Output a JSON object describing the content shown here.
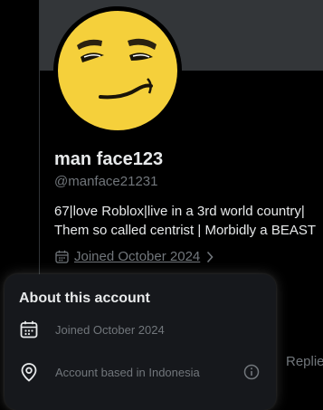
{
  "profile": {
    "display_name": "man face123",
    "handle": "@manface21231",
    "bio_lines": [
      "67|love Roblox|live in a 3rd world country|",
      "Them so called centrist | Morbidly a BEAST"
    ],
    "joined": "Joined October 2024",
    "avatar_icon": "man-face-avatar"
  },
  "tabs": {
    "replies_label": "Replie"
  },
  "about_popover": {
    "title": "About this account",
    "joined_row": {
      "icon": "calendar-icon",
      "text": "Joined October 2024"
    },
    "location_row": {
      "icon": "location-pin-icon",
      "text": "Account based in Indonesia",
      "info_icon": "info-icon"
    }
  },
  "colors": {
    "background": "#000000",
    "banner": "#333639",
    "primary_text": "#e7e9ea",
    "secondary_text": "#71767b",
    "popover_bg": "#16181c",
    "avatar_face": "#f5d03b"
  }
}
